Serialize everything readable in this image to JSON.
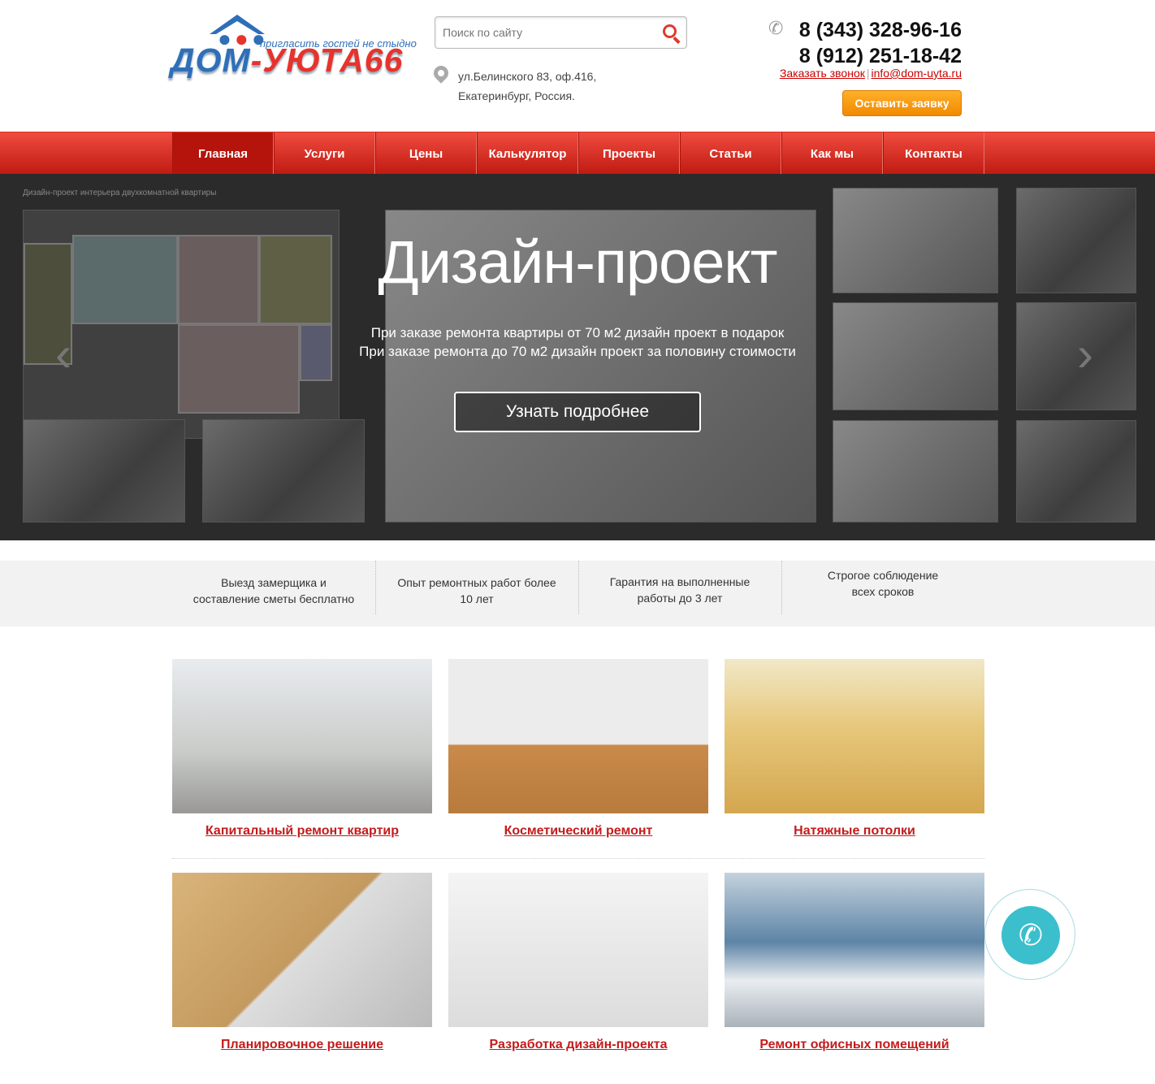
{
  "header": {
    "logo": {
      "main_a": "ДОМ",
      "main_b": "-УЮТА66",
      "slogan": "пригласить гостей не стыдно"
    },
    "search": {
      "placeholder": "Поиск по сайту"
    },
    "address": {
      "line1": "ул.Белинского 83, оф.416,",
      "line2": "Екатеринбург, Россия."
    },
    "phones": [
      "8 (343) 328-96-16",
      "8 (912) 251-18-42"
    ],
    "callback_link": "Заказать звонок",
    "divider": "|",
    "email": "info@dom-uyta.ru",
    "order_button": "Оставить заявку"
  },
  "nav": [
    "Главная",
    "Услуги",
    "Цены",
    "Калькулятор",
    "Проекты",
    "Статьи",
    "Как мы работаем",
    "Контакты"
  ],
  "hero": {
    "caption": "Дизайн-проект интерьера двухкомнатной квартиры",
    "title": "Дизайн-проект",
    "text1": "При заказе ремонта квартиры от 70 м2 дизайн проект в подарок",
    "text2": "При заказе ремонта до 70 м2 дизайн проект за половину стоимости",
    "button": "Узнать подробнее"
  },
  "features": [
    {
      "l1": "Выезд замерщика и",
      "l2": "составление сметы бесплатно"
    },
    {
      "l1": "Опыт ремонтных работ более",
      "l2": "10 лет"
    },
    {
      "l1": "Гарантия на выполненные",
      "l2": "работы до 3 лет"
    },
    {
      "l1": "Строгое соблюдение",
      "l2": "всех сроков"
    }
  ],
  "services": [
    "Капитальный ремонт квартир",
    "Косметический ремонт",
    "Натяжные потолки",
    "Планировочное решение",
    "Разработка дизайн-проекта",
    "Ремонт офисных помещений"
  ],
  "colors": {
    "accent": "#d9281e",
    "orange": "#f7a11a",
    "teal": "#3bbfcc"
  },
  "icons": {
    "search": "search-icon",
    "phone": "phone-icon",
    "pin": "location-pin-icon",
    "call": "call-widget-icon"
  }
}
